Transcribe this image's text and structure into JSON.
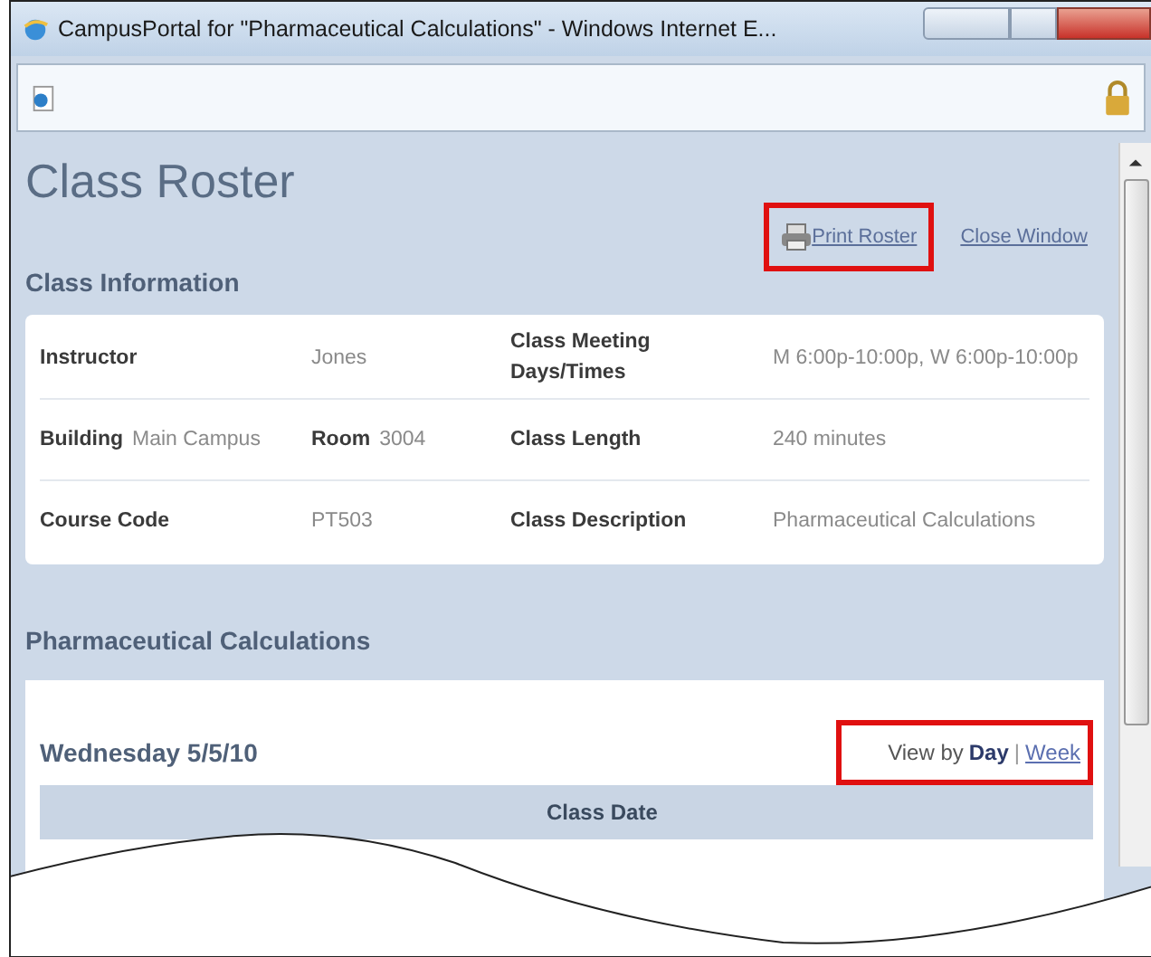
{
  "window": {
    "title": "CampusPortal for \"Pharmaceutical Calculations\" - Windows Internet E..."
  },
  "page": {
    "title": "Class Roster",
    "actions": [
      {
        "kind": "print",
        "label": "Print Roster",
        "highlighted": true
      },
      {
        "kind": "link",
        "label": "Close Window",
        "highlighted": false
      }
    ],
    "info_heading": "Class Information",
    "info_rows": [
      [
        {
          "parts": [
            {
              "kind": "label",
              "text": "Instructor"
            }
          ]
        },
        {
          "parts": [
            {
              "kind": "value",
              "text": "Jones"
            }
          ]
        },
        {
          "parts": [
            {
              "kind": "label",
              "text": "Class Meeting Days/Times"
            }
          ]
        },
        {
          "parts": [
            {
              "kind": "value",
              "text": "M 6:00p-10:00p, W 6:00p-10:00p"
            }
          ]
        }
      ],
      [
        {
          "parts": [
            {
              "kind": "label",
              "text": "Building"
            },
            {
              "kind": "value",
              "text": "Main Campus"
            }
          ]
        },
        {
          "parts": [
            {
              "kind": "label",
              "text": "Room"
            },
            {
              "kind": "value",
              "text": "3004"
            }
          ]
        },
        {
          "parts": [
            {
              "kind": "label",
              "text": "Class Length"
            }
          ]
        },
        {
          "parts": [
            {
              "kind": "value",
              "text": "240 minutes"
            }
          ]
        }
      ],
      [
        {
          "parts": [
            {
              "kind": "label",
              "text": "Course Code"
            }
          ]
        },
        {
          "parts": [
            {
              "kind": "value",
              "text": "PT503"
            }
          ]
        },
        {
          "parts": [
            {
              "kind": "label",
              "text": "Class Description"
            }
          ]
        },
        {
          "parts": [
            {
              "kind": "value",
              "text": "Pharmaceutical Calculations"
            }
          ]
        }
      ]
    ],
    "course_heading": "Pharmaceutical Calculations",
    "date": "Wednesday 5/5/10",
    "view_by": {
      "label": "View by",
      "separator": "|",
      "highlighted": true,
      "options": [
        {
          "label": "Day",
          "selected": true
        },
        {
          "label": "Week",
          "selected": false
        }
      ]
    },
    "table": {
      "columns": [
        {
          "label": "Class Date"
        }
      ]
    }
  }
}
